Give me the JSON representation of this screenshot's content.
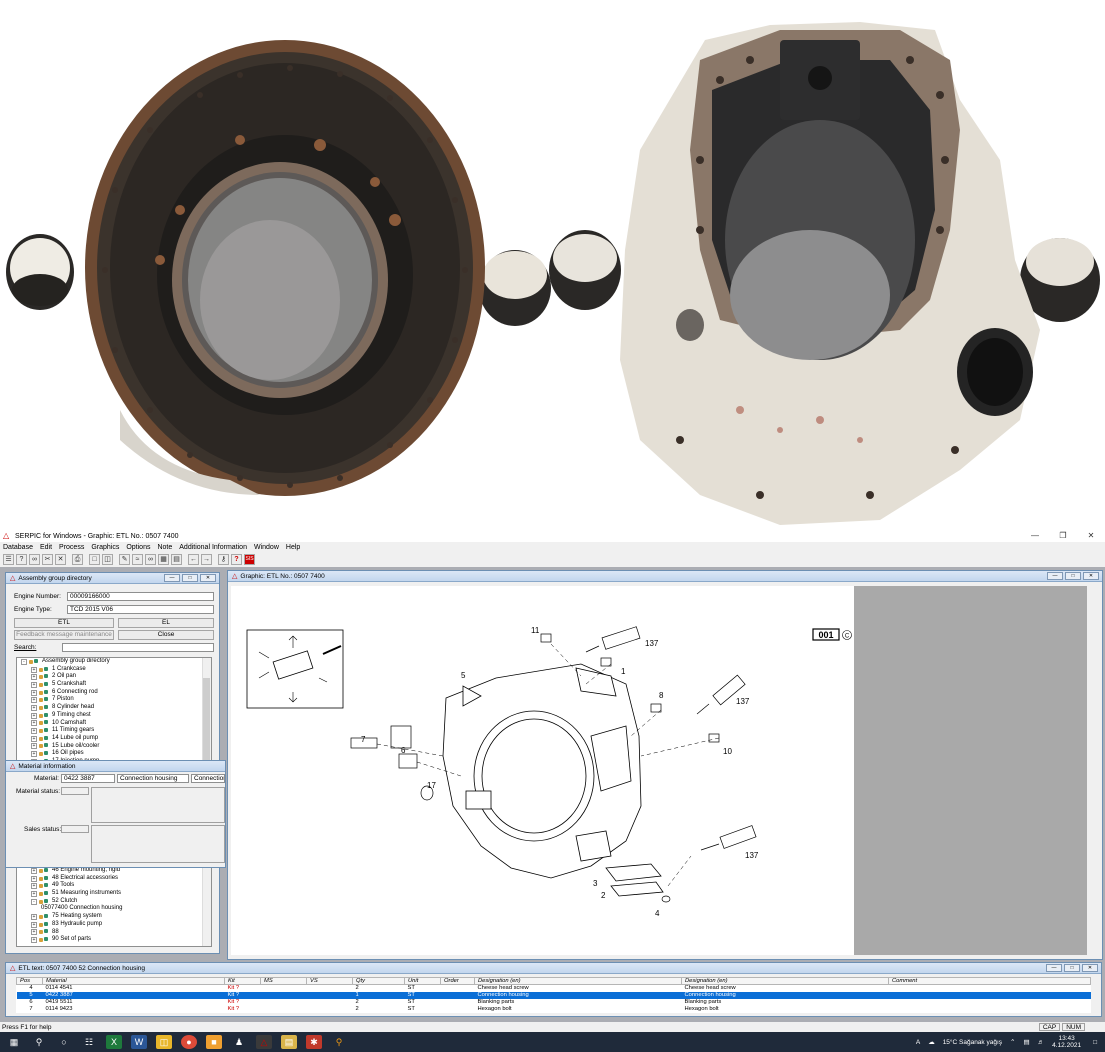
{
  "window": {
    "title": "SERPIC for Windows - Graphic: ETL No.: 0507 7400"
  },
  "menu": [
    "Database",
    "Edit",
    "Process",
    "Graphics",
    "Options",
    "Note",
    "Additional Information",
    "Window",
    "Help"
  ],
  "assembly": {
    "title": "Assembly group directory",
    "engine_number_label": "Engine Number:",
    "engine_number": "00009166000",
    "engine_type_label": "Engine Type:",
    "engine_type": "TCD 2015 V06",
    "etl_button": "ETL",
    "el_button": "EL",
    "feedback_button": "Feedback message maintenance",
    "close_button": "Close",
    "search_label": "Search:",
    "tree_items": [
      {
        "label": "Assembly group directory",
        "level": 0,
        "exp": "-"
      },
      {
        "label": "1  Crankcase",
        "level": 1,
        "exp": "+"
      },
      {
        "label": "2  Oil pan",
        "level": 1,
        "exp": "+"
      },
      {
        "label": "5  Crankshaft",
        "level": 1,
        "exp": "+"
      },
      {
        "label": "6  Connecting rod",
        "level": 1,
        "exp": "+"
      },
      {
        "label": "7  Piston",
        "level": 1,
        "exp": "+"
      },
      {
        "label": "8  Cylinder head",
        "level": 1,
        "exp": "+"
      },
      {
        "label": "9  Timing chest",
        "level": 1,
        "exp": "+"
      },
      {
        "label": "10  Camshaft",
        "level": 1,
        "exp": "+"
      },
      {
        "label": "11  Timing gears",
        "level": 1,
        "exp": "+"
      },
      {
        "label": "14  Lube oil pump",
        "level": 1,
        "exp": "+"
      },
      {
        "label": "15  Lube oil/cooler",
        "level": 1,
        "exp": "+"
      },
      {
        "label": "16  Oil pipes",
        "level": 1,
        "exp": "+"
      },
      {
        "label": "17  Injection pump",
        "level": 1,
        "exp": "+"
      }
    ],
    "tree_items_lower": [
      {
        "label": "46  Engine mounting, rigid",
        "level": 1,
        "exp": "+"
      },
      {
        "label": "48  Electrical accessories",
        "level": 1,
        "exp": "+"
      },
      {
        "label": "49  Tools",
        "level": 1,
        "exp": "+"
      },
      {
        "label": "51  Measuring instruments",
        "level": 1,
        "exp": "+"
      },
      {
        "label": "52  Clutch",
        "level": 1,
        "exp": "-"
      },
      {
        "label": "05077400  Connection housing",
        "level": 2,
        "exp": ""
      },
      {
        "label": "75  Heating system",
        "level": 1,
        "exp": "+"
      },
      {
        "label": "83  Hydraulic pump",
        "level": 1,
        "exp": "+"
      },
      {
        "label": "88",
        "level": 1,
        "exp": "+"
      },
      {
        "label": "90  Set of parts",
        "level": 1,
        "exp": "+"
      }
    ]
  },
  "material": {
    "title": "Material information",
    "material_label": "Material:",
    "material_value": "0422 3887",
    "material_name": "Connection housing",
    "material_name2": "Connection",
    "material_status_label": "Material status:",
    "sales_status_label": "Sales status:"
  },
  "graphic": {
    "title": "Graphic: ETL No.: 0507 7400",
    "page_tag": "001",
    "callouts": [
      "11",
      "137",
      "1",
      "5",
      "8",
      "137",
      "10",
      "7",
      "6",
      "17",
      "3",
      "2",
      "4",
      "137"
    ]
  },
  "etl": {
    "title": "ETL text: 0507 7400    52   Connection housing",
    "columns": [
      "Pos",
      "Material",
      "Kit",
      "MS",
      "VS",
      "Qty",
      "Unit",
      "Order",
      "Designation (en)",
      "Designation (en)",
      "Comment"
    ],
    "rows": [
      {
        "pos": "4",
        "material": "0114 4541",
        "kit": "Kit ?",
        "qty": "2",
        "unit": "ST",
        "d1": "Cheese head screw",
        "d2": "Cheese head screw",
        "selected": false
      },
      {
        "pos": "5",
        "material": "0422 3887",
        "kit": "Kit ?",
        "qty": "1",
        "unit": "ST",
        "d1": "Connection housing",
        "d2": "Connection housing",
        "selected": true
      },
      {
        "pos": "6",
        "material": "0419 5511",
        "kit": "Kit ?",
        "qty": "2",
        "unit": "ST",
        "d1": "Blanking parts",
        "d2": "Blanking parts",
        "selected": false
      },
      {
        "pos": "7",
        "material": "0114 9423",
        "kit": "Kit ?",
        "qty": "2",
        "unit": "ST",
        "d1": "Hexagon bolt",
        "d2": "Hexagon bolt",
        "selected": false
      }
    ]
  },
  "status": {
    "help": "Press F1 for help",
    "cap": "CAP",
    "num": "NUM"
  },
  "taskbar": {
    "weather": "15°C  Sağanak yağış",
    "time": "13:43",
    "date": "4.12.2021"
  },
  "colors": {
    "accent": "#0a6ed6",
    "brand_red": "#cc0000",
    "mdi_bg": "#abadb3",
    "taskbar": "#1f2a3a"
  }
}
